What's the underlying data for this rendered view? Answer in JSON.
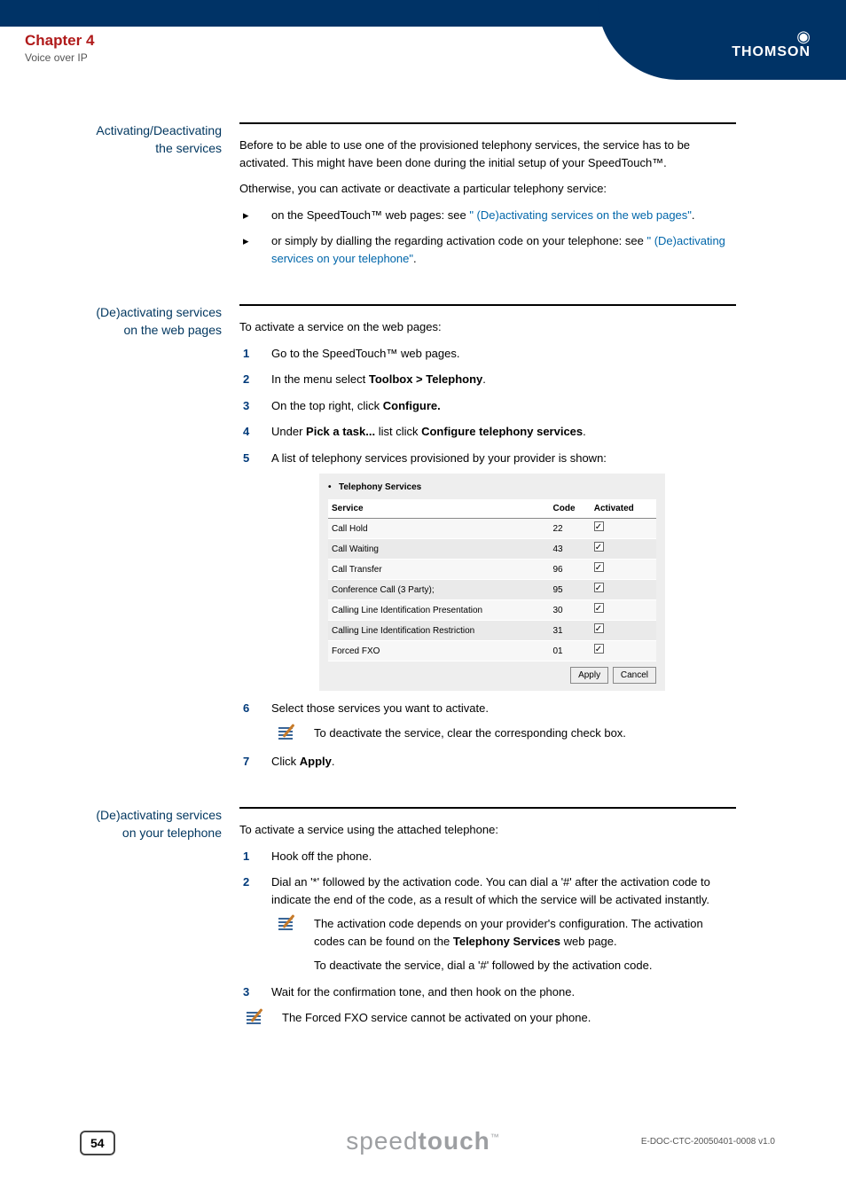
{
  "header": {
    "chapter": "Chapter 4",
    "subtitle": "Voice over IP",
    "brand": "THOMSON"
  },
  "sections": {
    "activating": {
      "heading_l1": "Activating/Deactivating",
      "heading_l2": "the services",
      "p1": "Before to be able to use one of the provisioned telephony services, the service has to be activated. This might have been done during the initial setup of your SpeedTouch™.",
      "p2": "Otherwise, you can activate or deactivate a particular telephony service:",
      "b1_pre": "on the SpeedTouch™ web pages: see ",
      "b1_link": "\" (De)activating services on the web pages\"",
      "b1_post": ".",
      "b2_pre": "or simply by dialling the regarding activation code on your telephone: see ",
      "b2_link": "\" (De)activating services on your telephone\"",
      "b2_post": "."
    },
    "web": {
      "heading_l1": "(De)activating services",
      "heading_l2": "on the web pages",
      "intro": "To activate a service on the web pages:",
      "s1": "Go to the SpeedTouch™ web pages.",
      "s2_pre": "In the menu select ",
      "s2_bold": "Toolbox > Telephony",
      "s2_post": ".",
      "s3_pre": "On the top right, click ",
      "s3_bold": "Configure.",
      "s4_pre": "Under ",
      "s4_bold1": "Pick a task...",
      "s4_mid": " list click ",
      "s4_bold2": "Configure telephony services",
      "s4_post": ".",
      "s5": "A list of telephony services provisioned by your provider is shown:",
      "table": {
        "title": "Telephony Services",
        "cols": {
          "service": "Service",
          "code": "Code",
          "activated": "Activated"
        },
        "rows": [
          {
            "service": "Call Hold",
            "code": "22"
          },
          {
            "service": "Call Waiting",
            "code": "43"
          },
          {
            "service": "Call Transfer",
            "code": "96"
          },
          {
            "service": "Conference Call (3 Party);",
            "code": "95"
          },
          {
            "service": "Calling Line Identification Presentation",
            "code": "30"
          },
          {
            "service": "Calling Line Identification Restriction",
            "code": "31"
          },
          {
            "service": "Forced FXO",
            "code": "01"
          }
        ],
        "apply": "Apply",
        "cancel": "Cancel"
      },
      "s6": "Select those services you want to activate.",
      "note6": "To deactivate the service, clear the corresponding check box.",
      "s7_pre": "Click ",
      "s7_bold": "Apply",
      "s7_post": "."
    },
    "phone": {
      "heading_l1": "(De)activating services",
      "heading_l2": "on your telephone",
      "intro": "To activate a service using the attached telephone:",
      "s1": "Hook off the phone.",
      "s2": "Dial an '*' followed by the activation code. You can dial a '#' after the activation code to indicate the end of the code, as a result of which the service will be activated instantly.",
      "note2a_pre": "The activation code depends on your provider's configuration. The activation codes can be found on the ",
      "note2a_bold": "Telephony Services",
      "note2a_post": " web page.",
      "note2b": "To deactivate the service, dial a '#' followed by the activation code.",
      "s3": "Wait for the confirmation tone, and then hook on the phone.",
      "note3": "The Forced FXO service cannot be activated on your phone."
    }
  },
  "footer": {
    "page": "54",
    "logo_thin": "speed",
    "logo_bold": "touch",
    "logo_tm": "™",
    "doc_id": "E-DOC-CTC-20050401-0008 v1.0"
  }
}
